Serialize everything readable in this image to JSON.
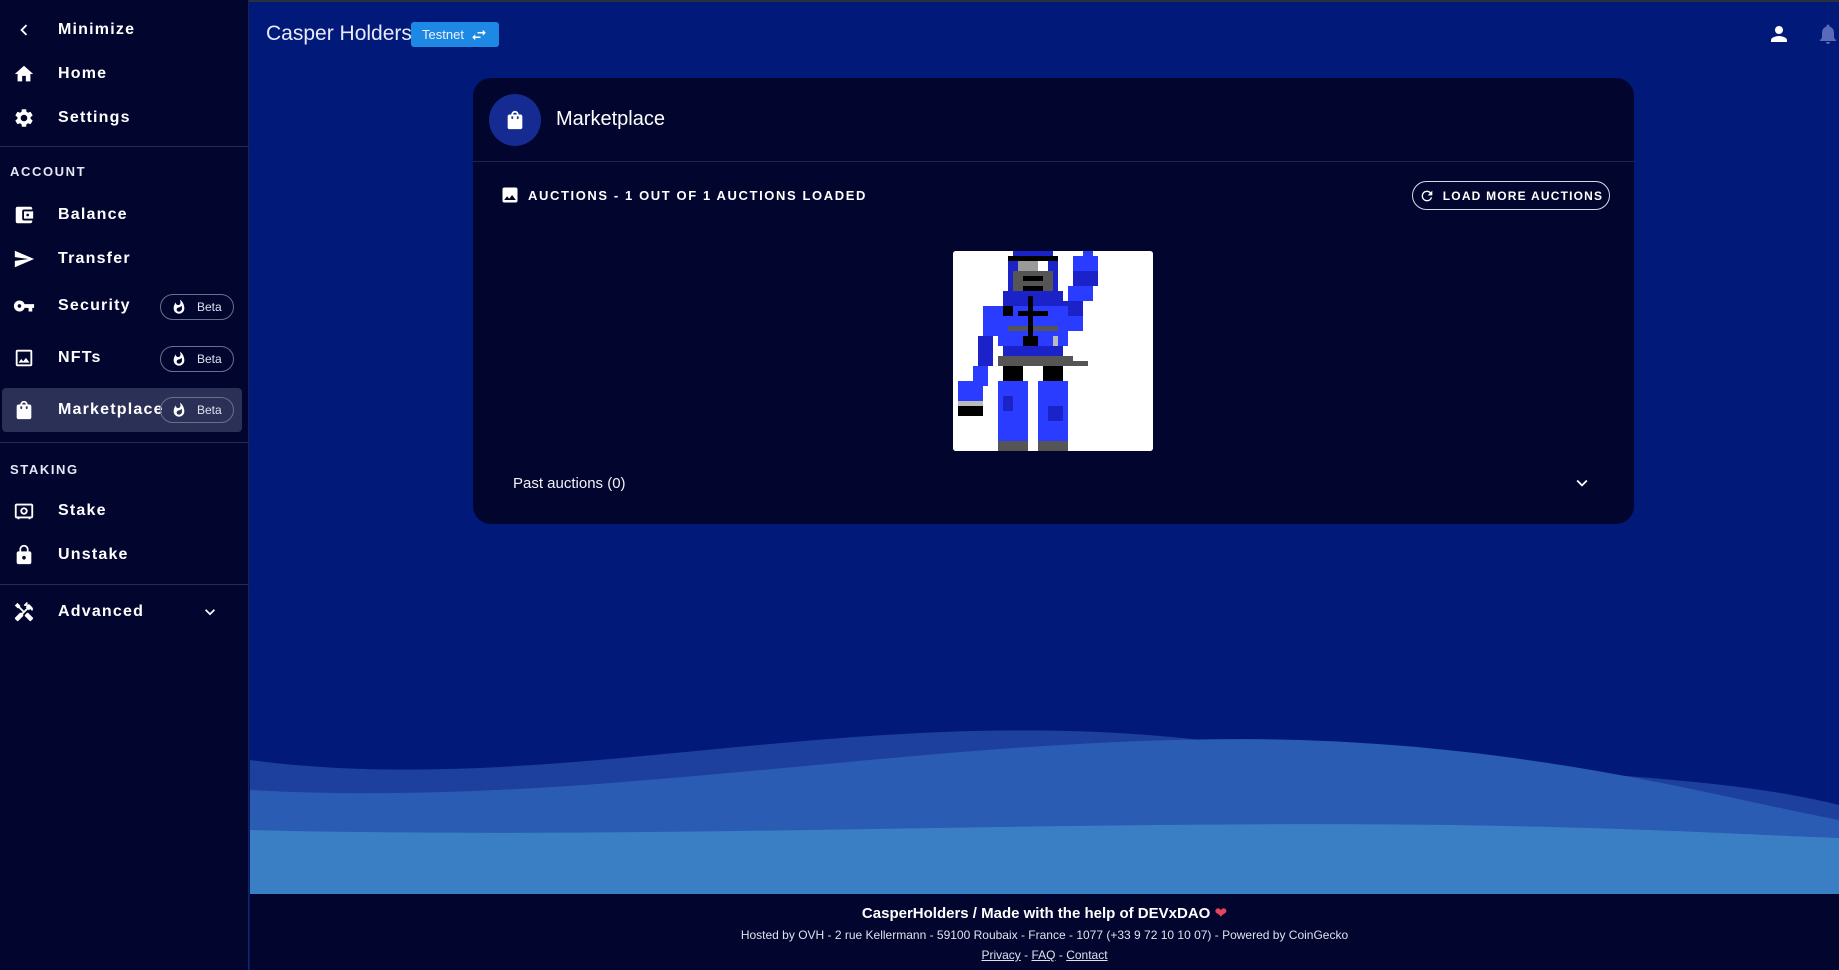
{
  "header": {
    "title": "Casper Holders",
    "network_badge": "Testnet"
  },
  "sidebar": {
    "minimize": "Minimize",
    "home": "Home",
    "settings": "Settings",
    "account_section": "ACCOUNT",
    "balance": "Balance",
    "transfer": "Transfer",
    "security": "Security",
    "nfts": "NFTs",
    "marketplace": "Marketplace",
    "beta": "Beta",
    "staking_section": "STAKING",
    "stake": "Stake",
    "unstake": "Unstake",
    "advanced": "Advanced",
    "active_item": "Marketplace"
  },
  "card": {
    "title": "Marketplace",
    "auctions_label": "AUCTIONS - 1 OUT OF 1 AUCTIONS LOADED",
    "load_more": "LOAD MORE AUCTIONS",
    "past_auctions": "Past auctions (0)"
  },
  "footer": {
    "title": "CasperHolders / Made with the help of DEVxDAO",
    "heart": "❤",
    "hosted": "Hosted by OVH - 2 rue Kellermann - 59100 Roubaix - France - 1077 (+33 9 72 10 10 07) - Powered by CoinGecko",
    "privacy": "Privacy",
    "faq": "FAQ",
    "contact": "Contact"
  },
  "colors": {
    "background": "#011a7a",
    "sidebar": "#02052e",
    "card": "#02052e",
    "testnet_badge": "#1e88e5",
    "active_item": "#2b3057"
  }
}
